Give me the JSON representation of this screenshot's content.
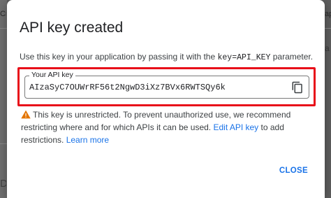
{
  "background": {
    "left_top_fragment": "Cre",
    "left_bottom_fragment": "DA",
    "right_top_fragment": "ap",
    "right_mid_fragment": "a"
  },
  "dialog": {
    "title": "API key created",
    "description_before": "Use this key in your application by passing it with the ",
    "description_code": "key=API_KEY",
    "description_after": " parameter.",
    "field_label": "Your API key",
    "api_key": "AIzaSyC7OUWrRF56t2NgwD3iXz7BVx6RWTSQy6k",
    "copy_icon": "content-copy-icon",
    "warning_icon": "warning-triangle-icon",
    "warning_text_1": "This key is unrestricted. To prevent unauthorized use, we recommend restricting where and for which APIs it can be used. ",
    "edit_link": "Edit API key",
    "warning_text_2": " to add restrictions. ",
    "learn_more_link": "Learn more",
    "close_label": "CLOSE"
  },
  "colors": {
    "highlight": "#e8101a",
    "link": "#1a73e8",
    "warning": "#e37400"
  }
}
